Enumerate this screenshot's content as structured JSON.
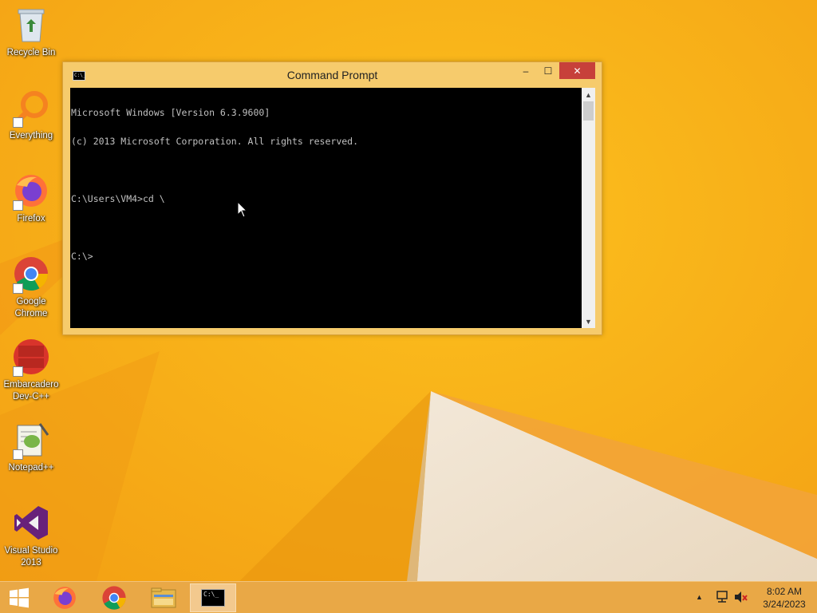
{
  "desktop": {
    "icons": [
      {
        "label": "Recycle Bin",
        "icon": "recycle-bin-icon"
      },
      {
        "label": "Everything",
        "icon": "everything-search-icon"
      },
      {
        "label": "Firefox",
        "icon": "firefox-icon"
      },
      {
        "label": "Google Chrome",
        "icon": "chrome-icon"
      },
      {
        "label": "Embarcadero Dev-C++",
        "icon": "devcpp-icon"
      },
      {
        "label": "Notepad++",
        "icon": "notepadpp-icon"
      },
      {
        "label": "Visual Studio 2013",
        "icon": "visual-studio-icon"
      }
    ]
  },
  "window": {
    "title": "Command Prompt",
    "icon": "cmd-icon",
    "title_icon_text": "C:\\_",
    "buttons": {
      "minimize": "–",
      "maximize": "☐",
      "close": "✕"
    },
    "console_lines": [
      "Microsoft Windows [Version 6.3.9600]",
      "(c) 2013 Microsoft Corporation. All rights reserved.",
      "",
      "C:\\Users\\VM4>cd \\",
      "",
      "C:\\>"
    ],
    "scroll": {
      "up": "▲",
      "down": "▼"
    }
  },
  "taskbar": {
    "items": [
      {
        "name": "start",
        "icon": "windows-logo-icon"
      },
      {
        "name": "firefox",
        "icon": "firefox-icon"
      },
      {
        "name": "chrome",
        "icon": "chrome-icon"
      },
      {
        "name": "file-explorer",
        "icon": "folder-icon"
      },
      {
        "name": "command-prompt",
        "icon": "cmd-icon",
        "active": true
      }
    ],
    "tray": {
      "arrow": "▲",
      "network_icon": "network-icon",
      "volume_icon": "volume-muted-icon",
      "time": "8:02 AM",
      "date": "3/24/2023"
    }
  },
  "colors": {
    "wallpaper": "#f7b016",
    "window_frame": "#f6cb6c",
    "close_button": "#c7403a",
    "console_bg": "#000000",
    "console_text": "#c0c0c0",
    "taskbar": "#e9a846"
  }
}
